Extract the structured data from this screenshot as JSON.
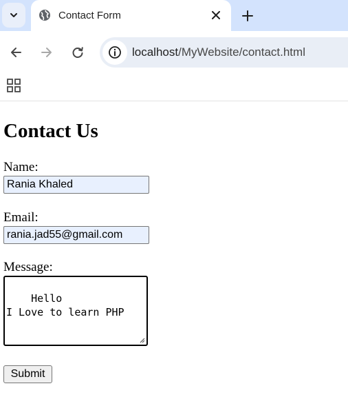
{
  "browser": {
    "tab_title": "Contact Form",
    "url_host": "localhost",
    "url_path": "/MyWebsite/contact.html"
  },
  "page": {
    "heading": "Contact Us",
    "name_label": "Name:",
    "name_value": "Rania Khaled",
    "email_label": "Email:",
    "email_value": "rania.jad55@gmail.com",
    "message_label": "Message:",
    "message_value": "Hello\nI Love to learn PHP",
    "submit_label": "Submit"
  },
  "icons": {
    "tab_menu": "chevron-down-icon",
    "favicon": "globe-icon",
    "close": "close-icon",
    "new_tab": "plus-icon",
    "back": "arrow-left-icon",
    "forward": "arrow-right-icon",
    "reload": "reload-icon",
    "site_info": "info-icon",
    "apps": "apps-grid-icon"
  },
  "colors": {
    "tabstrip": "#d3e3fd",
    "omnibox": "#e9eef6",
    "autofill": "#e8f0fe"
  }
}
